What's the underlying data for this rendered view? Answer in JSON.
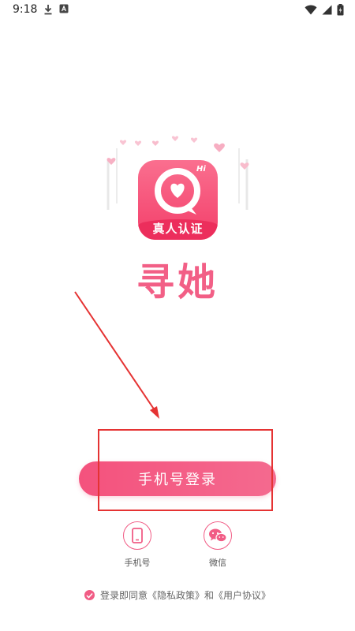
{
  "status_bar": {
    "time": "9:18",
    "left_icons": [
      "download-icon",
      "a-icon"
    ],
    "right_icons": [
      "wifi-icon",
      "signal-icon",
      "battery-icon"
    ]
  },
  "logo": {
    "badge_text": "真人认证",
    "hi_text": "Hi"
  },
  "app": {
    "name": "寻她"
  },
  "login": {
    "phone_login_label": "手机号登录"
  },
  "alt_login": [
    {
      "label": "手机号",
      "icon": "phone-icon"
    },
    {
      "label": "微信",
      "icon": "wechat-icon"
    }
  ],
  "agreement": {
    "prefix": "登录即同意",
    "privacy": "《隐私政策》",
    "and": "和",
    "terms": "《用户协议》"
  },
  "colors": {
    "accent": "#f4527d",
    "annotation": "#e53333"
  }
}
